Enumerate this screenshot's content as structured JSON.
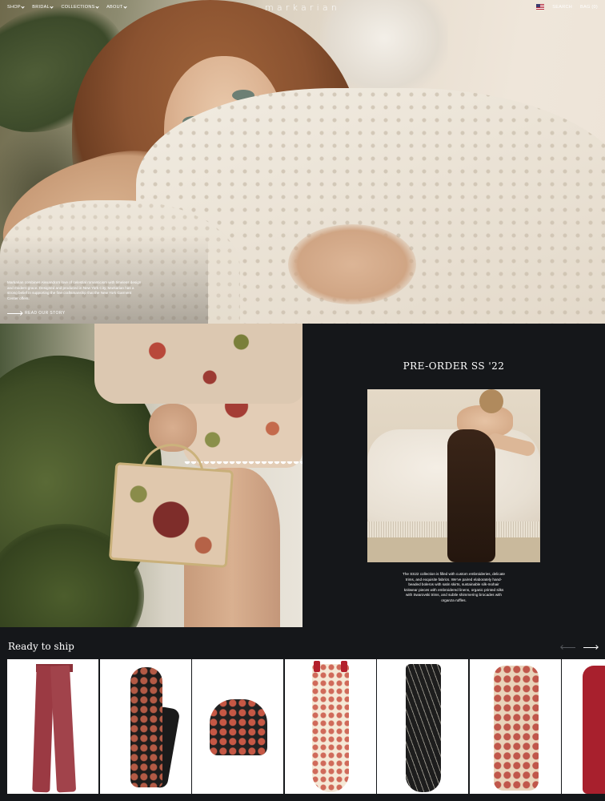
{
  "nav": {
    "items": [
      {
        "label": "SHOP"
      },
      {
        "label": "BRIDAL"
      },
      {
        "label": "COLLECTIONS"
      },
      {
        "label": "ABOUT"
      }
    ],
    "logo": "markarian",
    "search_label": "SEARCH",
    "bag_label": "BAG (0)",
    "flag_icon": "us-flag-icon"
  },
  "hero": {
    "text": "Markarian combines Alexandra's love of celestial romanticism with timeless design and modern grace. Designed and produced in New York City, Markarian has a strong belief in supporting the fine craftsmanship that the New York Garment Center offers.",
    "story_link": "READ OUR STORY"
  },
  "preorder": {
    "title": "PRE-ORDER SS '22",
    "text": "The SS22 collection is filled with custom embroideries, delicate trims, and exquisite fabrics. We've paired elaborately hand-beaded boleros with satin skirts, sustainable silk-mohair knitwear pieces with embroidered linens, organic printed silks with Swarovski trims, and subtle shimmering brocades with organza ruffles."
  },
  "ready_to_ship": {
    "title": "Ready to ship",
    "prev_icon": "arrow-left-icon",
    "next_icon": "arrow-right-icon",
    "products": [
      {
        "name": "product-card-1"
      },
      {
        "name": "product-card-2"
      },
      {
        "name": "product-card-3"
      },
      {
        "name": "product-card-4"
      },
      {
        "name": "product-card-5"
      },
      {
        "name": "product-card-6"
      },
      {
        "name": "product-card-7"
      }
    ]
  },
  "colors": {
    "background_dark": "#15171a",
    "text": "#ffffff"
  }
}
